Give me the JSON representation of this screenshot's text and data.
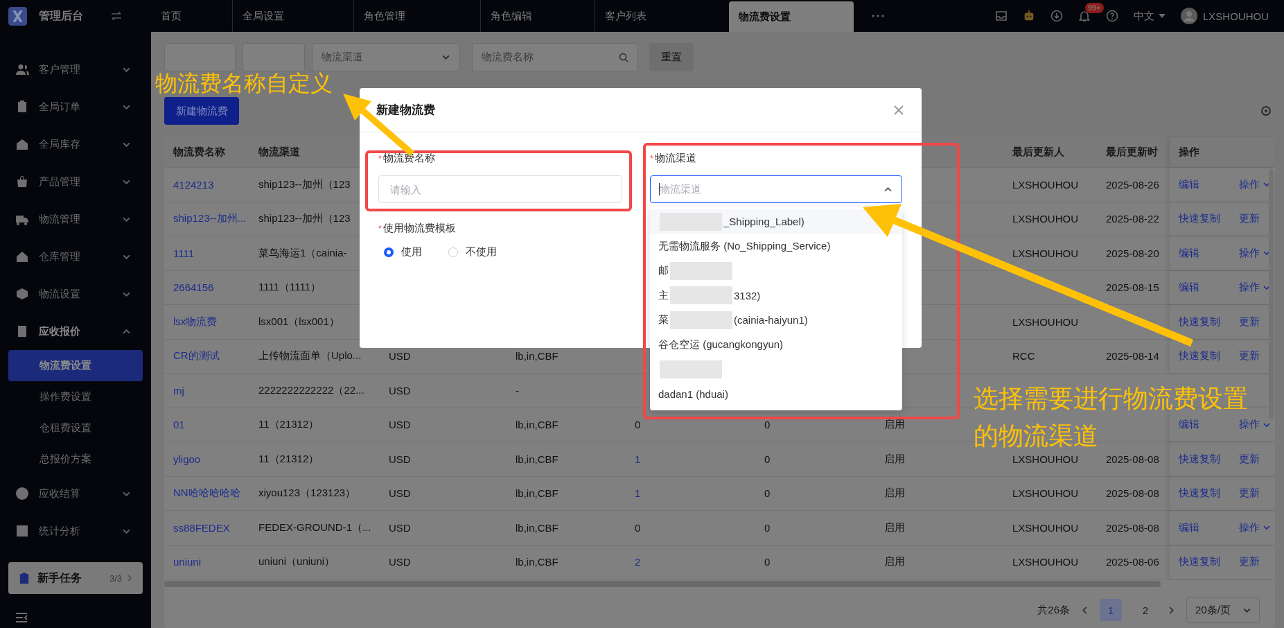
{
  "topbar": {
    "title": "管理后台",
    "tabs": [
      {
        "label": "首页",
        "selected": false
      },
      {
        "label": "全局设置",
        "selected": false
      },
      {
        "label": "角色管理",
        "selected": false
      },
      {
        "label": "角色编辑",
        "selected": false
      },
      {
        "label": "客户列表",
        "selected": false
      },
      {
        "label": "物流费设置",
        "selected": true
      }
    ],
    "notification_count": "99+",
    "language": "中文",
    "user": "LXSHOUHOU"
  },
  "sidebar": {
    "items": [
      {
        "label": "客户管理",
        "expanded": false
      },
      {
        "label": "全局订单",
        "expanded": false
      },
      {
        "label": "全局库存",
        "expanded": false
      },
      {
        "label": "产品管理",
        "expanded": false
      },
      {
        "label": "物流管理",
        "expanded": false
      },
      {
        "label": "仓库管理",
        "expanded": false
      },
      {
        "label": "物流设置",
        "expanded": false
      },
      {
        "label": "应收报价",
        "expanded": true,
        "children": [
          {
            "label": "物流费设置",
            "selected": true
          },
          {
            "label": "操作费设置",
            "selected": false
          },
          {
            "label": "仓租费设置",
            "selected": false
          },
          {
            "label": "总报价方案",
            "selected": false
          }
        ]
      },
      {
        "label": "应收结算",
        "expanded": false
      },
      {
        "label": "统计分析",
        "expanded": false
      }
    ],
    "task_card": {
      "label": "新手任务",
      "progress": "3/3"
    }
  },
  "toolbar": {
    "channel_placeholder": "物流渠道",
    "search_placeholder": "物流费名称",
    "reset_button": "重置",
    "new_button": "新建物流费"
  },
  "table": {
    "columns": {
      "name": "物流费名称",
      "channel": "物流渠道",
      "updater": "最后更新人",
      "updated": "最后更新时",
      "actions": "操作"
    },
    "rows": [
      {
        "name": "4124213",
        "channel": "ship123--加州（123",
        "updater": "LXSHOUHOU",
        "updated": "2025-08-26",
        "actions": [
          {
            "label": "编辑",
            "kind": "link"
          },
          {
            "label": "操作",
            "kind": "menu"
          }
        ]
      },
      {
        "name": "ship123--加州...",
        "channel": "ship123--加州（123",
        "updater": "LXSHOUHOU",
        "updated": "2025-08-22",
        "actions": [
          {
            "label": "快速复制",
            "kind": "link"
          },
          {
            "label": "更新",
            "kind": "link"
          }
        ]
      },
      {
        "name": "1111",
        "channel": "菜鸟海运1（cainia-",
        "updater": "LXSHOUHOU",
        "updated": "2025-08-20",
        "actions": [
          {
            "label": "编辑",
            "kind": "link"
          },
          {
            "label": "操作",
            "kind": "menu"
          }
        ]
      },
      {
        "name": "2664156",
        "channel": "1111（1111）",
        "updated": "2025-08-15",
        "actions": [
          {
            "label": "编辑",
            "kind": "link"
          },
          {
            "label": "操作",
            "kind": "menu"
          }
        ]
      },
      {
        "name": "lsx物流费",
        "channel": "lsx001（lsx001）",
        "updater": "LXSHOUHOU",
        "actions": [
          {
            "label": "快速复制",
            "kind": "link"
          },
          {
            "label": "更新",
            "kind": "link"
          }
        ]
      },
      {
        "name": "CR的测试",
        "channel": "上传物流面单（Uplo...",
        "currency": "USD",
        "unit": "lb,in,CBF",
        "updater": "RCC",
        "updated": "2025-08-14",
        "actions": [
          {
            "label": "快速复制",
            "kind": "link"
          },
          {
            "label": "更新",
            "kind": "link"
          }
        ]
      },
      {
        "name": "mj",
        "channel": "2222222222222（22...",
        "currency": "USD",
        "unit": "-"
      },
      {
        "name": "01",
        "channel": "11（21312）",
        "currency": "USD",
        "unit": "lb,in,CBF",
        "count": "0",
        "count_link": false,
        "column_6": "0",
        "status": "启用",
        "actions": [
          {
            "label": "编辑",
            "kind": "link"
          },
          {
            "label": "操作",
            "kind": "menu"
          }
        ]
      },
      {
        "name": "yligoo",
        "channel": "11（21312）",
        "currency": "USD",
        "unit": "lb,in,CBF",
        "count": "1",
        "count_link": true,
        "column_6": "0",
        "status": "启用",
        "updater": "LXSHOUHOU",
        "updated": "2025-08-08",
        "actions": [
          {
            "label": "快速复制",
            "kind": "link"
          },
          {
            "label": "更新",
            "kind": "link"
          }
        ]
      },
      {
        "name": "NN哈哈哈哈哈",
        "channel": "xiyou123（123123）",
        "currency": "USD",
        "unit": "lb,in,CBF",
        "count": "1",
        "count_link": true,
        "column_6": "0",
        "status": "启用",
        "updater": "LXSHOUHOU",
        "updated": "2025-08-08",
        "actions": [
          {
            "label": "快速复制",
            "kind": "link"
          },
          {
            "label": "更新",
            "kind": "link"
          }
        ]
      },
      {
        "name": "ss88FEDEX",
        "channel": "FEDEX-GROUND-1（...",
        "currency": "USD",
        "unit": "lb,in,CBF",
        "count": "0",
        "count_link": false,
        "column_6": "0",
        "status": "启用",
        "updater": "LXSHOUHOU",
        "updated": "2025-08-08",
        "actions": [
          {
            "label": "编辑",
            "kind": "link"
          },
          {
            "label": "操作",
            "kind": "menu"
          }
        ]
      },
      {
        "name": "uniuni",
        "channel": "uniuni（uniuni）",
        "currency": "USD",
        "unit": "lb,in,CBF",
        "count": "2",
        "count_link": true,
        "column_6": "0",
        "status": "启用",
        "updater": "LXSHOUHOU",
        "updated": "2025-08-06",
        "actions": [
          {
            "label": "快速复制",
            "kind": "link"
          },
          {
            "label": "更新",
            "kind": "link"
          }
        ]
      }
    ]
  },
  "pagination": {
    "total": "共26条",
    "pages": [
      {
        "label": "1",
        "selected": true
      },
      {
        "label": "2",
        "selected": false
      }
    ],
    "page_size": "20条/页"
  },
  "dialog": {
    "title": "新建物流费",
    "name_field": {
      "label": "物流费名称",
      "required_mark": "*",
      "placeholder": "请输入"
    },
    "template_field": {
      "label": "使用物流费模板",
      "required_mark": "*",
      "options": [
        {
          "label": "使用",
          "selected": true
        },
        {
          "label": "不使用",
          "selected": false
        }
      ]
    },
    "channel_field": {
      "label": "物流渠道",
      "required_mark": "*",
      "placeholder": "物流渠道",
      "expanded": true,
      "options": [
        {
          "redacted": true,
          "after": "_Shipping_Label)",
          "highlighted": true,
          "selected": false
        },
        {
          "before": "无需物流服务 (No_Shipping_Service)",
          "redacted": false,
          "highlighted": false,
          "selected": false
        },
        {
          "before": "邮",
          "redacted": true,
          "highlighted": false,
          "selected": false
        },
        {
          "before": "主",
          "redacted": true,
          "after": "3132)",
          "highlighted": false,
          "selected": false
        },
        {
          "before": "菜",
          "redacted": true,
          "after": "(cainia-haiyun1)",
          "highlighted": false,
          "selected": false
        },
        {
          "before": "谷仓空运 (gucangkongyun)",
          "redacted": false,
          "highlighted": false,
          "selected": false
        },
        {
          "redacted": true,
          "highlighted": false,
          "selected": false
        },
        {
          "before": "dadan1 (hduai)",
          "redacted": false,
          "highlighted": false,
          "selected": false
        }
      ]
    }
  },
  "annotations": [
    {
      "text": "物流费名称自定义"
    },
    {
      "text": "选择需要进行物流费设置"
    },
    {
      "text": "的物流渠道"
    }
  ]
}
